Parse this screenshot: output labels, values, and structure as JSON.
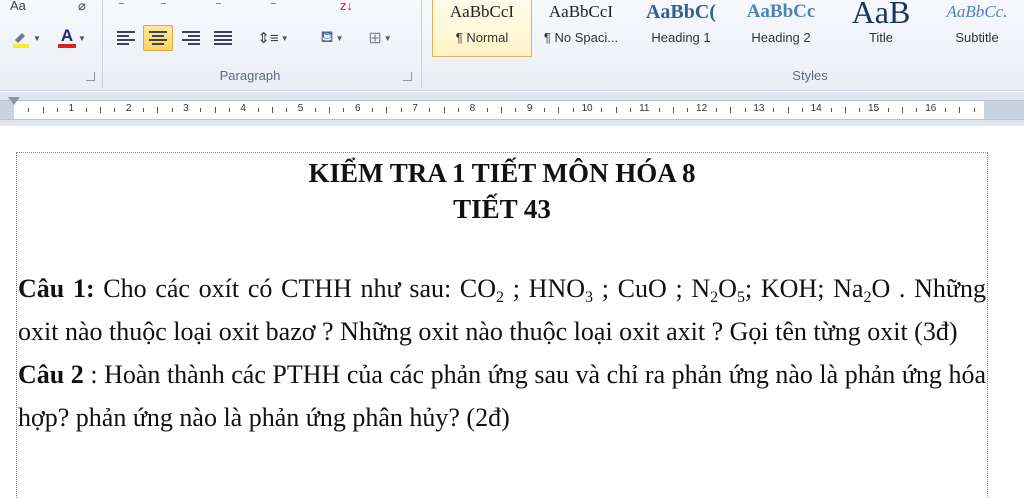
{
  "ribbon": {
    "paragraph_group_label": "Paragraph",
    "styles_group_label": "Styles",
    "font_top_partial": "Aa",
    "highlight_icon": "highlighter-icon",
    "font_color_icon": "font-color-icon",
    "font_color_letter": "A",
    "font_color_accent": "#e02020",
    "highlight_accent": "#f5ee30",
    "styles": [
      {
        "sample": "AaBbCcI",
        "name": "¶ Normal",
        "selected": true
      },
      {
        "sample": "AaBbCcI",
        "name": "¶ No Spaci..."
      },
      {
        "sample": "AaBbC(",
        "name": "Heading 1"
      },
      {
        "sample": "AaBbCc",
        "name": "Heading 2"
      },
      {
        "sample": "AaB",
        "name": "Title"
      },
      {
        "sample": "AaBbCc.",
        "name": "Subtitle"
      }
    ]
  },
  "ruler": {
    "numbers": [
      "1",
      "2",
      "3",
      "4",
      "5",
      "6",
      "7",
      "8",
      "9",
      "10",
      "11",
      "12",
      "13",
      "14",
      "15",
      "16"
    ]
  },
  "document": {
    "title_line1": "KIỂM TRA 1 TIẾT MÔN HÓA 8",
    "title_line2": "TIẾT 43",
    "q1_label": "Câu 1:",
    "q1_text_a": " Cho các oxít có CTHH như sau: CO",
    "q1_sub_co2": "2",
    "q1_text_b": " ; HNO",
    "q1_sub_hno3": "3",
    "q1_text_c": " ; CuO ; N",
    "q1_sub_n": "2",
    "q1_text_d": "O",
    "q1_sub_o5": "5",
    "q1_text_e": "; KOH; Na",
    "q1_sub_na": "2",
    "q1_text_f": "O . Những oxit nào thuộc loại oxit bazơ ? Những oxit nào thuộc loại oxit axit ? Gọi tên từng oxit (3đ)",
    "q2_label": "Câu 2",
    "q2_text": " : Hoàn thành các PTHH  của các phản ứng sau và chỉ ra phản ứng nào là phản ứng hóa hợp? phản ứng nào là phản ứng phân hủy? (2đ)"
  }
}
